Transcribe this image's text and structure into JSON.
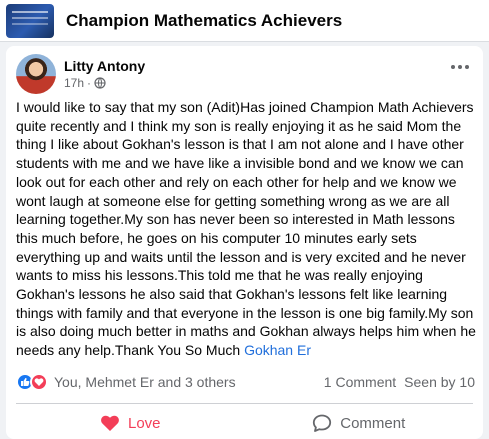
{
  "group": {
    "name": "Champion Mathematics Achievers"
  },
  "post": {
    "author": "Litty Antony",
    "time": "17h",
    "dot": "·",
    "text": "I would like to say that my son (Adit)Has joined Champion Math Achievers quite recently and I think my son is really enjoying it as he said Mom the thing I like about Gokhan's lesson is that I am not alone and I have other students with me and we have like a invisible bond and we know we can look out for each other and rely on each other for help and we know we wont laugh at someone else for getting something wrong as we are all learning together.My son has never been so interested in Math lessons this much before, he goes on his computer 10 minutes early sets everything up and waits until the lesson and is very excited and he never wants to miss his lessons.This told me that he was really enjoying Gokhan's lessons he also said that Gokhan's lessons felt like learning things with family and that everyone in the lesson is one big family.My son is also doing much better in maths and Gokhan always helps him when he needs any help.Thank You So Much ",
    "mention": "Gokhan Er"
  },
  "reactions": {
    "names": "You, Mehmet Er and 3 others",
    "comments": "1 Comment",
    "seen": "Seen by 10"
  },
  "actions": {
    "love": "Love",
    "comment": "Comment"
  },
  "colors": {
    "love": "#f33e58",
    "like": "#1877f2",
    "link": "#216fdb",
    "muted": "#65676b"
  },
  "icons": [
    "globe-icon",
    "more-icon",
    "like-reaction-icon",
    "love-reaction-icon",
    "heart-icon",
    "comment-icon"
  ]
}
